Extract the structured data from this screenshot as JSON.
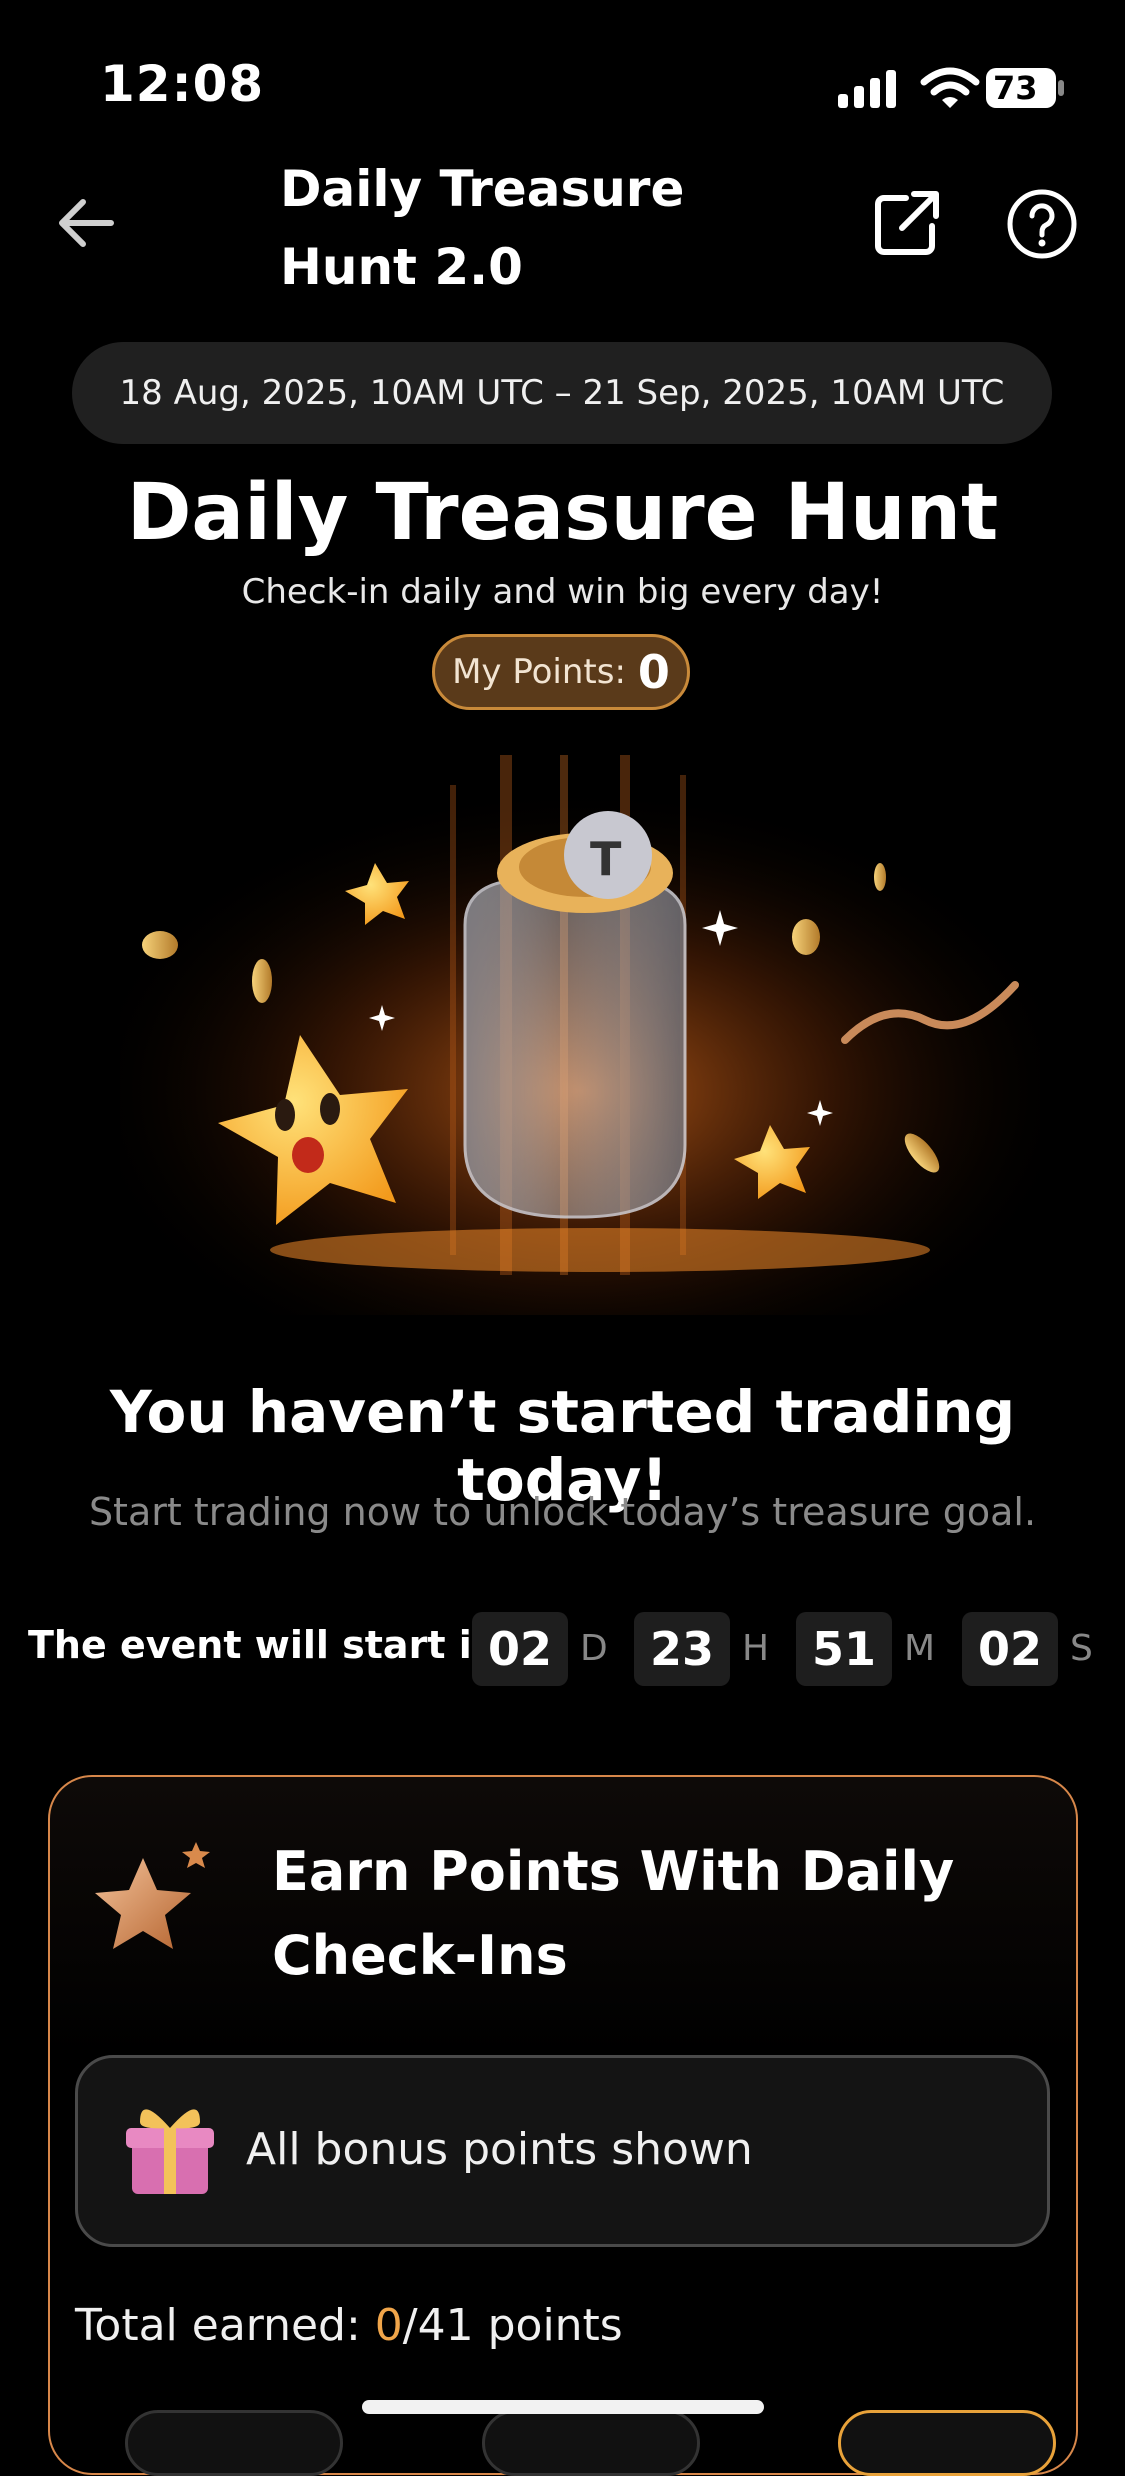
{
  "status_bar": {
    "time": "12:08",
    "battery": "73"
  },
  "header": {
    "title": "Daily Treasure Hunt 2.0"
  },
  "date_range": "18 Aug, 2025, 10AM UTC – 21 Sep, 2025, 10AM UTC",
  "hero": {
    "title": "Daily Treasure Hunt",
    "subtitle": "Check-in daily and win big every day!",
    "points_label": "My Points:",
    "points_value": "0"
  },
  "message": {
    "title": "You haven’t started trading today!",
    "subtitle": "Start trading now to unlock today’s treasure goal."
  },
  "countdown": {
    "label": "The event will start in",
    "days": "02",
    "days_unit": "D",
    "hours": "23",
    "hours_unit": "H",
    "minutes": "51",
    "minutes_unit": "M",
    "seconds": "02",
    "seconds_unit": "S"
  },
  "card": {
    "title": "Earn Points With Daily Check-Ins",
    "bonus_text": "All bonus points shown",
    "total_prefix": "Total earned: ",
    "total_earned": "0",
    "total_suffix": "/41 points"
  },
  "colors": {
    "accent": "#f0a54a",
    "pill_bg": "#5a3a1a",
    "card_border": "#d7874a"
  },
  "icons": [
    "back-arrow-icon",
    "share-icon",
    "help-icon",
    "star-icon",
    "gift-icon"
  ]
}
